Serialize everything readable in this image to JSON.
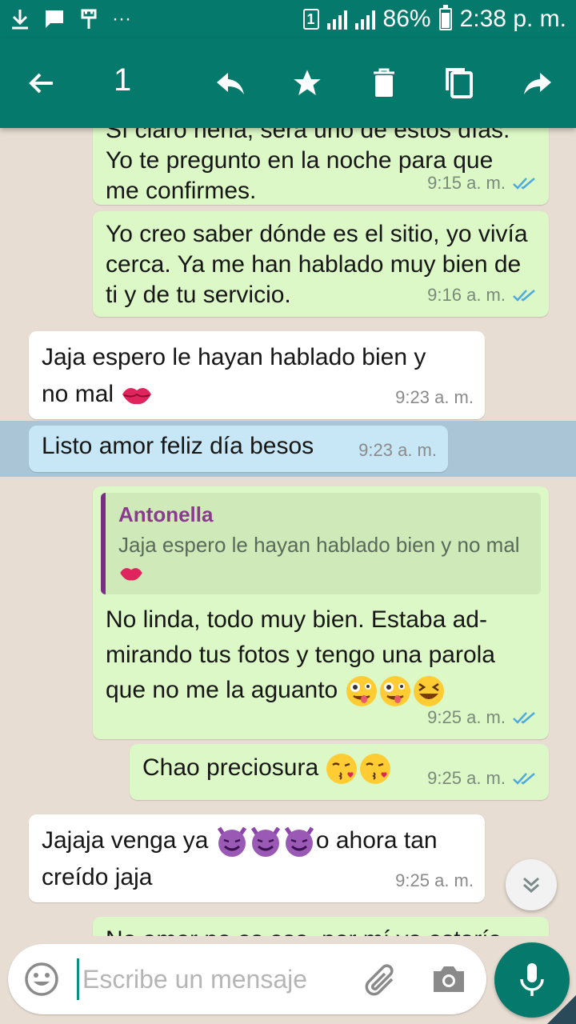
{
  "status_bar": {
    "sim": "1",
    "battery": "86%",
    "time": "2:38 p. m.",
    "dots": "···"
  },
  "action_bar": {
    "selected_count": "1"
  },
  "messages": [
    {
      "id": "m1",
      "dir": "out",
      "text_partial": "Sí claro nena, será uno de estos días.",
      "text": "Yo te pregunto en la noche para que me confirmes.",
      "time": "9:15 a. m."
    },
    {
      "id": "m2",
      "dir": "out",
      "text": "Yo creo saber dónde es el sitio, yo vivía cerca. Ya me han hablado muy bien de ti y de tu servicio.",
      "time": "9:16 a. m."
    },
    {
      "id": "m3",
      "dir": "in",
      "text": "Jaja espero le hayan hablado bien y no mal",
      "time": "9:23 a. m."
    },
    {
      "id": "m4",
      "dir": "in",
      "text": "Listo amor feliz día besos",
      "time": "9:23 a. m.",
      "selected": true
    },
    {
      "id": "m5",
      "dir": "out",
      "quote_name": "Antonella",
      "quote_text": "Jaja espero le hayan hablado bien y no mal",
      "text": "No linda, todo muy bien. Estaba ad-mirando tus fotos y tengo una parola que no me la aguanto",
      "time": "9:25 a. m."
    },
    {
      "id": "m6",
      "dir": "out",
      "text": "Chao preciosura",
      "time": "9:25 a. m."
    },
    {
      "id": "m7",
      "dir": "in",
      "text_a": "Jajaja venga ya",
      "text_b": "o ahora tan",
      "text_c": "creído jaja",
      "time": "9:25 a. m."
    },
    {
      "id": "m8",
      "dir": "out",
      "text_partial": "No amor no es eso, por mí ya estaría"
    }
  ],
  "composer": {
    "placeholder": "Escribe un mensaje"
  },
  "colors": {
    "header": "#05796b",
    "outgoing": "#dcf8c6",
    "incoming": "#ffffff",
    "selection": "#5faadc",
    "quote_bar": "#7a2e86"
  },
  "icons": [
    "download-icon",
    "message-icon",
    "usb-icon",
    "back-arrow-icon",
    "reply-icon",
    "star-icon",
    "delete-icon",
    "copy-icon",
    "forward-icon",
    "double-check-icon",
    "kiss-mark-emoji",
    "zany-face-emoji",
    "grinning-squinting-emoji",
    "face-blowing-kiss-emoji",
    "smiling-devil-emoji",
    "chevron-down-icon",
    "smiley-icon",
    "attach-icon",
    "camera-icon",
    "microphone-icon"
  ]
}
